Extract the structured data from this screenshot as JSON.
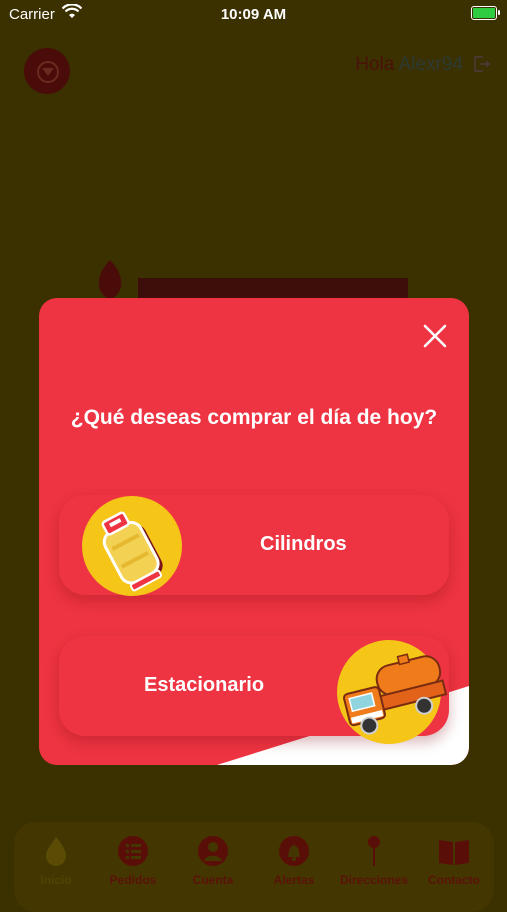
{
  "status_bar": {
    "carrier": "Carrier",
    "time": "10:09 AM"
  },
  "header": {
    "greeting": "Hola",
    "username": "Alexr94"
  },
  "modal": {
    "question": "¿Qué deseas comprar el día de hoy?",
    "options": [
      {
        "label": "Cilindros",
        "icon": "gas-cylinder-icon"
      },
      {
        "label": "Estacionario",
        "icon": "tanker-truck-icon"
      }
    ]
  },
  "nav": {
    "items": [
      {
        "label": "Inicio",
        "icon": "flame-icon",
        "active": true
      },
      {
        "label": "Pedidos",
        "icon": "list-icon"
      },
      {
        "label": "Cuenta",
        "icon": "user-icon"
      },
      {
        "label": "Alertas",
        "icon": "bell-icon"
      },
      {
        "label": "Direcciones",
        "icon": "location-pin-icon"
      },
      {
        "label": "Contacto",
        "icon": "book-icon"
      }
    ]
  },
  "colors": {
    "modal_red": "#ee3442",
    "accent_yellow": "#f5c518",
    "overlay": "#3b3000"
  }
}
